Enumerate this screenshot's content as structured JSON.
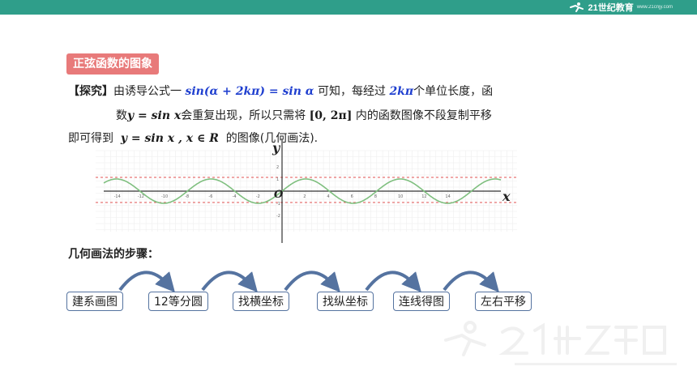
{
  "header": {
    "logo_text": "21世纪教育",
    "logo_sub": "www.21cnjy.com"
  },
  "title": "正弦函数的图象",
  "explore": {
    "label": "【探究】",
    "line1_pre": "由诱导公式一",
    "formula1": "sin(α + 2kπ) = sin α",
    "line1_mid": "可知，每经过",
    "formula2": "2kπ",
    "line1_post": "个单位长度，函",
    "line2_pre": "数",
    "formula3": "y = sin x",
    "line2_mid": "会重复出现，所以只需将",
    "formula4": "[0, 2π]",
    "line2_post": "内的函数图像不段复制平移",
    "line3_pre": "即可得到",
    "formula5": "y = sin x , x ∈ R",
    "line3_post": "的图像(几何画法)."
  },
  "graph": {
    "x_axis_label": "x",
    "y_axis_label": "y",
    "origin_label": "O",
    "x_ticks": [
      "-14",
      "-12",
      "-10",
      "-8",
      "-6",
      "-4",
      "-2",
      "2",
      "4",
      "6",
      "8",
      "10",
      "12",
      "14"
    ],
    "y_ticks": [
      "2",
      "1",
      "-1",
      "-2"
    ],
    "curve_color": "#7fbf7f",
    "guide_color": "#e05050"
  },
  "steps_title": "几何画法的步骤：",
  "steps": [
    "建系画图",
    "12等分圆",
    "找横坐标",
    "找纵坐标",
    "连线得图",
    "左右平移"
  ],
  "colors": {
    "teal": "#2f9e8a",
    "badge": "#e87a7a",
    "formula_blue": "#1f3fcf",
    "step_border": "#5573a0",
    "arc_color": "#5573a0"
  }
}
